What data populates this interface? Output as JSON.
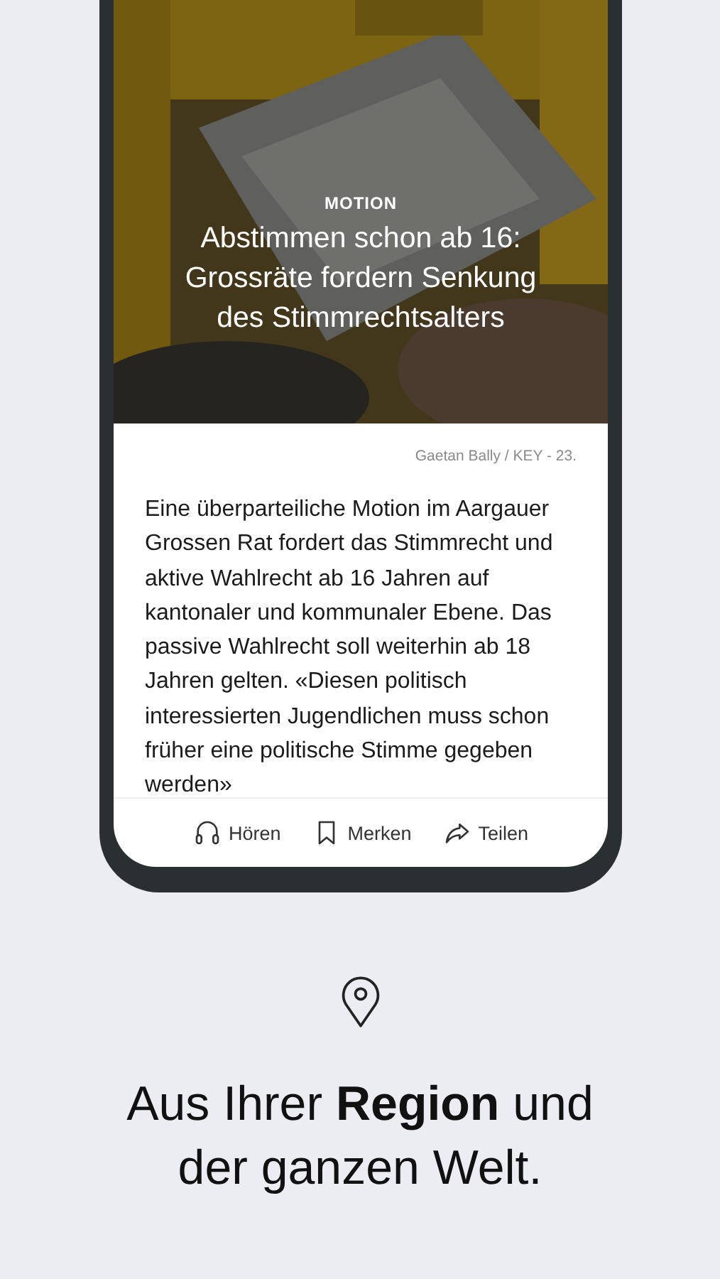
{
  "article": {
    "category": "MOTION",
    "headline": "Abstimmen schon ab 16: Grossräte fordern Senkung des Stimmrechtsalters",
    "credit": "Gaetan Bally / KEY - 23.",
    "body": "Eine überparteiliche Motion im Aargauer Grossen Rat fordert das Stimmrecht und aktive Wahlrecht ab 16 Jahren auf kantonaler und kommunaler Ebene. Das passive Wahlrecht soll weiterhin ab 18 Jahren gelten. «Diesen politisch interessierten Jugendlichen muss schon früher eine politische Stimme gegeben werden»"
  },
  "actions": [
    {
      "kind": "listen",
      "label": "Hören"
    },
    {
      "kind": "bookmark",
      "label": "Merken"
    },
    {
      "kind": "share",
      "label": "Teilen"
    }
  ],
  "caption": "Aus Ihrer **Region** und der ganzen Welt."
}
